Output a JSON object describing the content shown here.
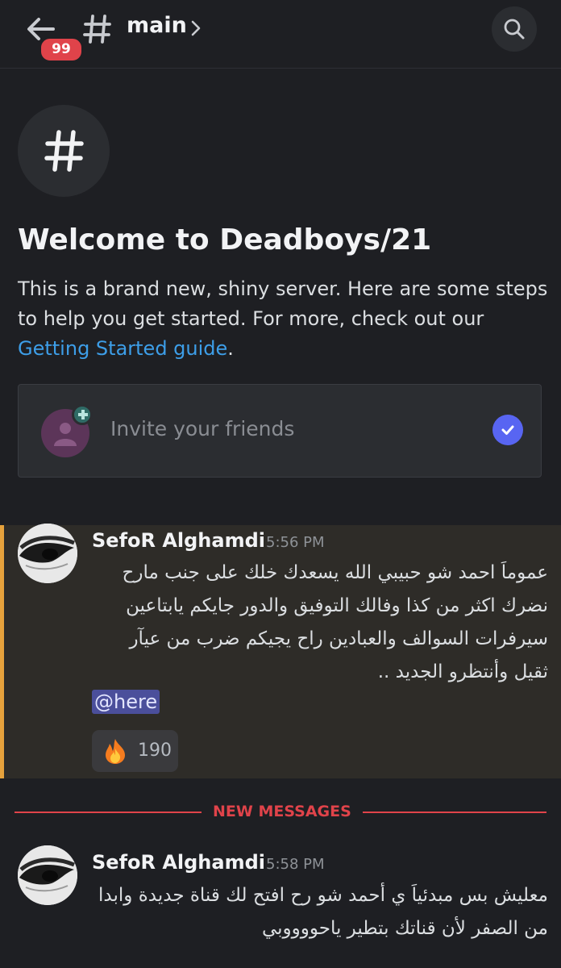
{
  "header": {
    "badge_count": "99",
    "channel_name": "main",
    "back_icon": "arrow-left-icon",
    "search_icon": "search-icon"
  },
  "welcome": {
    "title": "Welcome to Deadboys/21",
    "description": "This is a brand new, shiny server. Here are some steps to help you get started. For more, check out our ",
    "link_text": "Getting Started guide",
    "description_end": "."
  },
  "invite": {
    "label": "Invite your friends"
  },
  "messages": [
    {
      "username": "SefoR Alghamdi",
      "time": "5:56 PM",
      "lines": [
        "عموماَ احمد شو حبيبي الله يسعدك خلك على جنب مارح",
        "نضرك اكثر من كذا وفالك التوفيق والدور جايكم يابتاعين",
        "سيرفرات السوالف والعبادين راح يجيكم ضرب من عيآر",
        "ثقيل وأنتظرو الجديد .."
      ],
      "mention": "@here",
      "reaction_emoji": "fire",
      "reaction_count": "190"
    },
    {
      "username": "SefoR Alghamdi",
      "time": "5:58 PM",
      "lines": [
        "معليش بس مبدئياَ ي أحمد شو رح افتح لك قناة جديدة وابدا",
        "من الصفر لأن قناتك بتطير ياحووووبي"
      ]
    }
  ],
  "divider": {
    "label": "NEW MESSAGES"
  },
  "colors": {
    "background": "#1e1f23",
    "accent_link": "#3d9ee8",
    "new_messages": "#e0434a",
    "highlight_bar": "#e6a23c",
    "mention_bg": "#4b4f9b",
    "check": "#5865f2"
  }
}
